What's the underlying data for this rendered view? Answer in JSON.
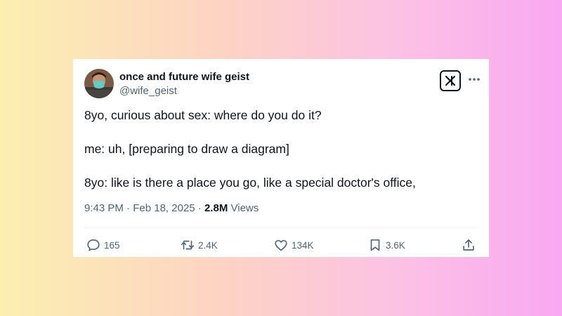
{
  "tweet": {
    "display_name": "once and future wife geist",
    "handle": "@wife_geist",
    "lines": [
      "8yo, curious about sex: where do you do it?",
      "me: uh, [preparing to draw a diagram]",
      "8yo: like is there a place you go, like a special doctor's office,"
    ],
    "time": "9:43 PM",
    "separator": "·",
    "date": "Feb 18, 2025",
    "views_count": "2.8M",
    "views_label": "Views"
  },
  "actions": {
    "replies": "165",
    "reposts": "2.4K",
    "likes": "134K",
    "bookmarks": "3.6K"
  },
  "icons": {
    "brand": "x-logo-icon",
    "more": "more-horizontal-icon",
    "reply": "reply-icon",
    "repost": "repost-icon",
    "like": "heart-icon",
    "bookmark": "bookmark-icon",
    "share": "share-icon"
  },
  "colors": {
    "text": "#0f1419",
    "secondary": "#536471",
    "gradient_left": "#fcefb0",
    "gradient_right": "#f9a8f2"
  }
}
